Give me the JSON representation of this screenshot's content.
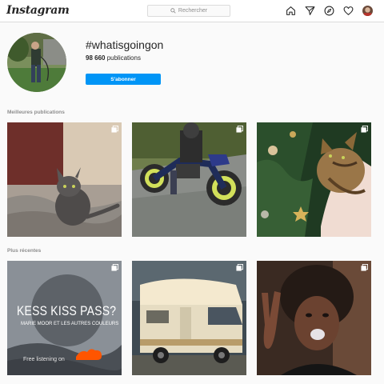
{
  "app": {
    "logo": "Instagram"
  },
  "search": {
    "placeholder": "Rechercher"
  },
  "nav": {
    "icons": [
      "home-icon",
      "direct-icon",
      "explore-icon",
      "heart-icon",
      "profile-avatar"
    ]
  },
  "header": {
    "hashtag": "#whatisgoingon",
    "post_count": "98 660",
    "post_count_label": "publications",
    "follow_label": "S'abonner"
  },
  "sections": {
    "top_label": "Meilleures publications",
    "recent_label": "Plus récentes"
  },
  "posts": {
    "top": [
      {
        "subject": "grey kitten on bed",
        "icon": "multi-image-icon"
      },
      {
        "subject": "person on dirt bike",
        "icon": "multi-image-icon"
      },
      {
        "subject": "cat on christmas tree",
        "icon": "multi-image-icon"
      }
    ],
    "recent": [
      {
        "subject": "music cover",
        "icon": "multi-image-icon",
        "headline": "KESS KISS PASS?",
        "subtitle": "MARIE MOOR ET LES AUTRES COULEURS",
        "footer": "Free listening on"
      },
      {
        "subject": "camper van",
        "icon": "multi-image-icon"
      },
      {
        "subject": "woman making peace sign",
        "icon": "multi-image-icon"
      }
    ]
  },
  "colors": {
    "accent": "#0095f6",
    "border": "#dbdbdb",
    "muted": "#8e8e8e",
    "soundcloud": "#ff5500"
  }
}
